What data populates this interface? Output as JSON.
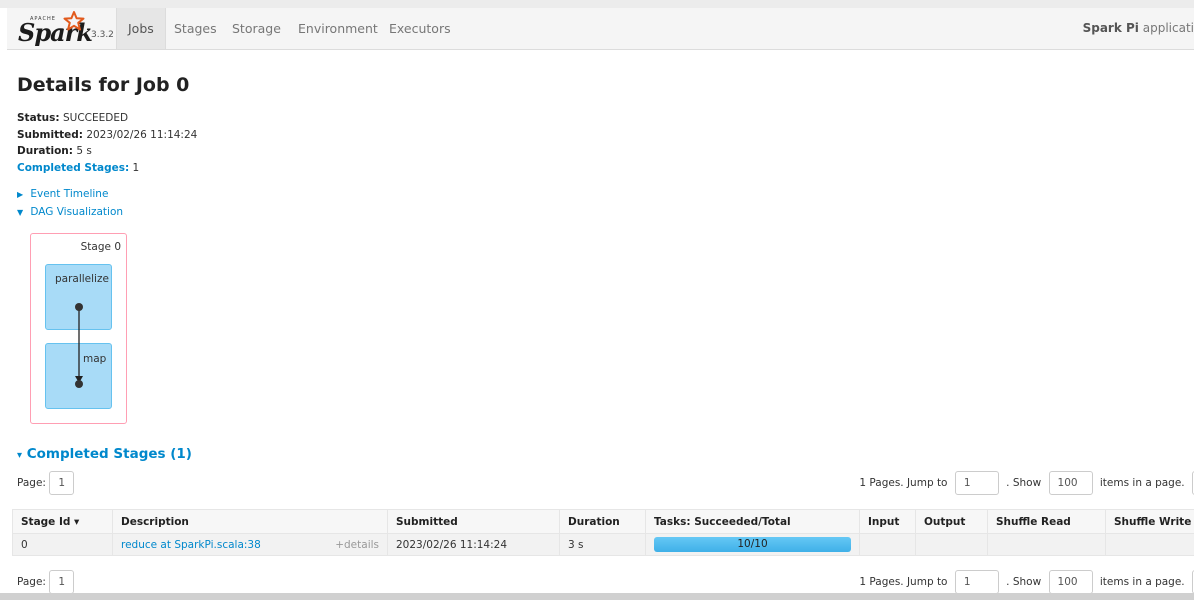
{
  "navbar": {
    "brand_small": "APACHE",
    "brand_name": "Spark",
    "version": "3.3.2",
    "tabs": [
      {
        "label": "Jobs",
        "active": true
      },
      {
        "label": "Stages",
        "active": false
      },
      {
        "label": "Storage",
        "active": false
      },
      {
        "label": "Environment",
        "active": false
      },
      {
        "label": "Executors",
        "active": false
      }
    ],
    "app_name": "Spark Pi",
    "app_suffix": "applicati"
  },
  "page": {
    "title": "Details for Job 0",
    "status_label": "Status:",
    "status_value": "SUCCEEDED",
    "submitted_label": "Submitted:",
    "submitted_value": "2023/02/26 11:14:24",
    "duration_label": "Duration:",
    "duration_value": "5 s",
    "completed_label": "Completed Stages:",
    "completed_value": "1"
  },
  "toggles": {
    "event_timeline": "Event Timeline",
    "dag_visualization": "DAG Visualization"
  },
  "dag": {
    "stage_label": "Stage 0",
    "nodes": [
      "parallelize",
      "map"
    ]
  },
  "completed_stages": {
    "heading": "Completed Stages (1)",
    "page_label": "Page:",
    "page_value": "1",
    "pages_text": "1 Pages. Jump to",
    "jump_value": "1",
    "show_text": ". Show",
    "show_value": "100",
    "items_text": "items in a page.",
    "columns": [
      "Stage Id ▾",
      "Description",
      "Submitted",
      "Duration",
      "Tasks: Succeeded/Total",
      "Input",
      "Output",
      "Shuffle Read",
      "Shuffle Write"
    ],
    "rows": [
      {
        "stage_id": "0",
        "description": "reduce at SparkPi.scala:38",
        "details": "+details",
        "submitted": "2023/02/26 11:14:24",
        "duration": "3 s",
        "tasks": "10/10",
        "tasks_fraction": 1.0,
        "input": "",
        "output": "",
        "shuffle_read": "",
        "shuffle_write": ""
      }
    ]
  },
  "colors": {
    "link": "#0088cc",
    "dag_node": "#a8dbf7",
    "dag_border": "#ff9eb3",
    "progress": "#5bc0f0"
  }
}
